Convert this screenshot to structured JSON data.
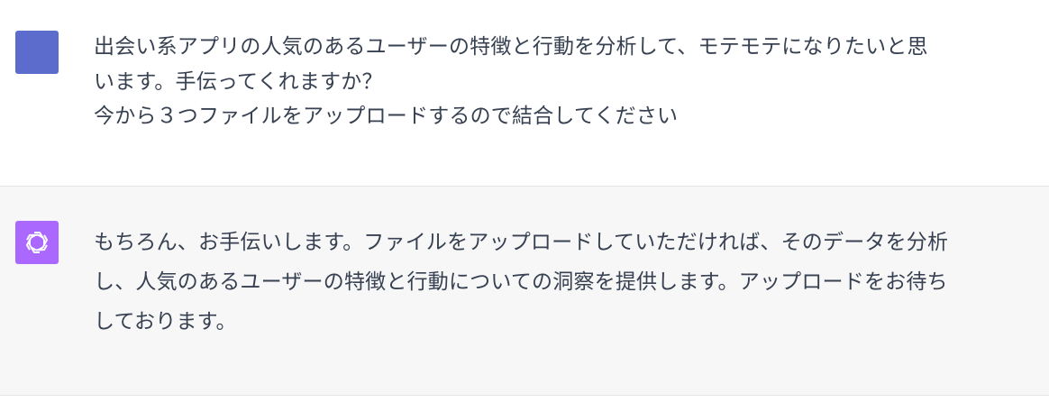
{
  "conversation": {
    "user_message": {
      "lines": [
        "出会い系アプリの人気のあるユーザーの特徴と行動を分析して、モテモテになりたいと思",
        "います。手伝ってくれますか？",
        "今から３つファイルをアップロードするので結合してください"
      ]
    },
    "assistant_message": {
      "lines": [
        "もちろん、お手伝いします。ファイルをアップロードしていただければ、そのデータを分析",
        "し、人気のあるユーザーの特徴と行動についての洞察を提供します。アップロードをお待ち",
        "しております。"
      ]
    }
  },
  "icons": {
    "user_avatar": "user-avatar-square",
    "assistant_avatar": "openai-logo-icon"
  },
  "colors": {
    "user_avatar_bg": "#5b6ccc",
    "assistant_avatar_bg": "#ab68ff",
    "assistant_row_bg": "#f7f7f8",
    "text": "#374151"
  }
}
